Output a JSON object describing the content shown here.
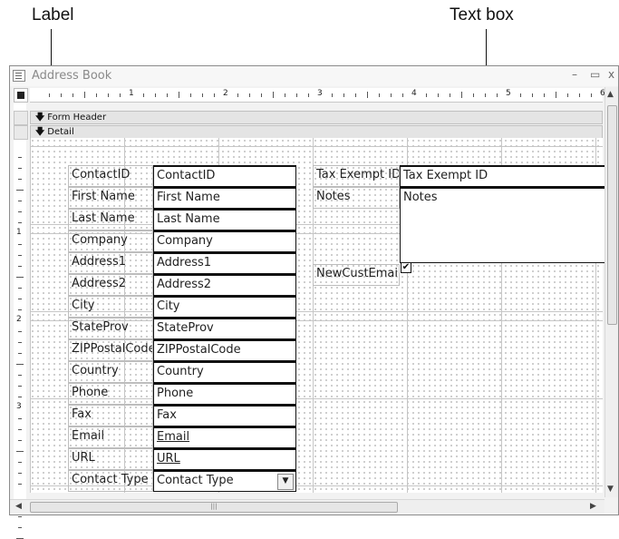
{
  "callouts": {
    "label": "Label",
    "text_box": "Text box"
  },
  "window": {
    "title": "Address Book",
    "minimize": "–",
    "restore": "▭",
    "close": "x"
  },
  "ruler": {
    "h_numbers": [
      "1",
      "2",
      "3",
      "4",
      "5",
      "6"
    ],
    "v_numbers": [
      "1",
      "2",
      "3"
    ]
  },
  "sections": {
    "form_header": "Form Header",
    "detail": "Detail"
  },
  "fields_left": [
    {
      "label": "ContactID",
      "value": "ContactID"
    },
    {
      "label": "First Name",
      "value": "First Name"
    },
    {
      "label": "Last Name",
      "value": "Last Name"
    },
    {
      "label": "Company",
      "value": "Company"
    },
    {
      "label": "Address1",
      "value": "Address1"
    },
    {
      "label": "Address2",
      "value": "Address2"
    },
    {
      "label": "City",
      "value": "City"
    },
    {
      "label": "StateProv",
      "value": "StateProv"
    },
    {
      "label": "ZIPPostalCode",
      "value": "ZIPPostalCode"
    },
    {
      "label": "Country",
      "value": "Country"
    },
    {
      "label": "Phone",
      "value": "Phone"
    },
    {
      "label": "Fax",
      "value": "Fax"
    },
    {
      "label": "Email",
      "value": "Email"
    },
    {
      "label": "URL",
      "value": "URL"
    },
    {
      "label": "Contact Type",
      "value": "Contact Type"
    }
  ],
  "fields_right": {
    "tax_label": "Tax Exempt ID",
    "tax_value": "Tax Exempt ID",
    "notes_label": "Notes",
    "notes_value": "Notes",
    "newcust_label": "NewCustEmail",
    "newcust_checked": "✔"
  },
  "combo_arrow": "▼",
  "scrollbar": {
    "up": "▲",
    "down": "▼",
    "left": "◀",
    "right": "▶",
    "grip": "|||"
  }
}
